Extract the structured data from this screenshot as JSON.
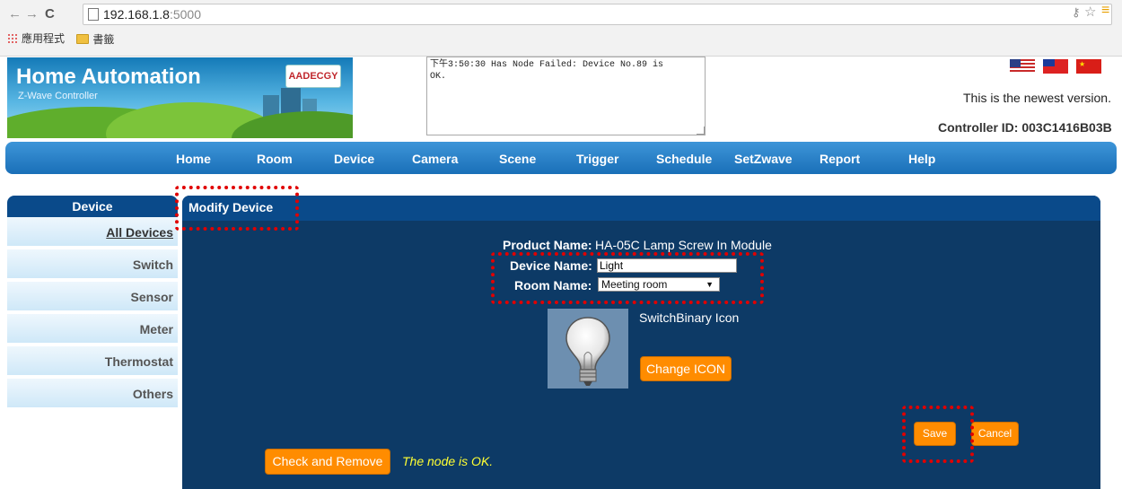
{
  "browser": {
    "url_host": "192.168.1.8",
    "url_port": ":5000",
    "bookmarks": [
      "應用程式",
      "書籤"
    ]
  },
  "header": {
    "banner_title": "Home Automation",
    "banner_subtitle": "Z-Wave Controller",
    "brand_logo": "AADECGY",
    "log_text": "下午3:50:30 Has Node Failed: Device No.89 is\nOK.",
    "version_text": "This is the newest version.",
    "controller_id": "Controller ID: 003C1416B03B",
    "flags": [
      "flag-us-icon",
      "flag-tw-icon",
      "flag-cn-icon"
    ]
  },
  "nav": {
    "items": [
      "Home",
      "Room",
      "Device",
      "Camera",
      "Scene",
      "Trigger",
      "Schedule",
      "SetZwave",
      "Report",
      "Help"
    ]
  },
  "sidebar": {
    "title": "Device",
    "items": [
      "All Devices",
      "Switch",
      "Sensor",
      "Meter",
      "Thermostat",
      "Others"
    ],
    "active": "All Devices"
  },
  "panel": {
    "title": "Modify Device",
    "product_label": "Product Name:",
    "product_value": "HA-05C Lamp Screw In Module",
    "device_label": "Device Name:",
    "device_value": "Light",
    "room_label": "Room Name:",
    "room_value": "Meeting room",
    "icon_type": "SwitchBinary Icon",
    "icon_name": "lightbulb-icon",
    "change_icon_label": "Change ICON",
    "save_label": "Save",
    "cancel_label": "Cancel",
    "check_remove_label": "Check and Remove",
    "node_status": "The node is OK."
  },
  "colors": {
    "nav_blue": "#1a6fb8",
    "panel_navy": "#0d3a66",
    "button_orange": "#ff8c00",
    "status_yellow": "#ffff33",
    "highlight_red": "#e00000"
  }
}
